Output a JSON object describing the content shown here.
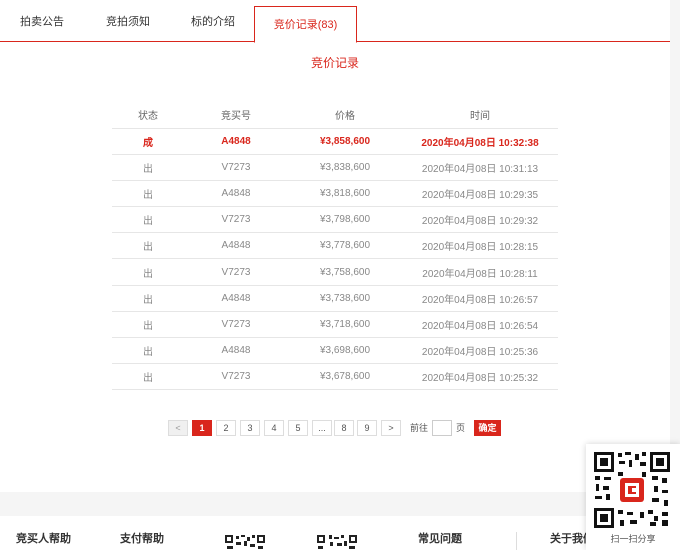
{
  "tabs": [
    {
      "label": "拍卖公告"
    },
    {
      "label": "竞拍须知"
    },
    {
      "label": "标的介绍"
    },
    {
      "label": "竞价记录(83)"
    }
  ],
  "section_title": "竞价记录",
  "table": {
    "headers": [
      "状态",
      "竞买号",
      "价格",
      "时间"
    ],
    "rows": [
      {
        "status": "成",
        "bidder": "A4848",
        "price": "¥3,858,600",
        "time": "2020年04月08日  10:32:38"
      },
      {
        "status": "出",
        "bidder": "V7273",
        "price": "¥3,838,600",
        "time": "2020年04月08日  10:31:13"
      },
      {
        "status": "出",
        "bidder": "A4848",
        "price": "¥3,818,600",
        "time": "2020年04月08日  10:29:35"
      },
      {
        "status": "出",
        "bidder": "V7273",
        "price": "¥3,798,600",
        "time": "2020年04月08日  10:29:32"
      },
      {
        "status": "出",
        "bidder": "A4848",
        "price": "¥3,778,600",
        "time": "2020年04月08日  10:28:15"
      },
      {
        "status": "出",
        "bidder": "V7273",
        "price": "¥3,758,600",
        "time": "2020年04月08日  10:28:11"
      },
      {
        "status": "出",
        "bidder": "A4848",
        "price": "¥3,738,600",
        "time": "2020年04月08日  10:26:57"
      },
      {
        "status": "出",
        "bidder": "V7273",
        "price": "¥3,718,600",
        "time": "2020年04月08日  10:26:54"
      },
      {
        "status": "出",
        "bidder": "A4848",
        "price": "¥3,698,600",
        "time": "2020年04月08日  10:25:36"
      },
      {
        "status": "出",
        "bidder": "V7273",
        "price": "¥3,678,600",
        "time": "2020年04月08日  10:25:32"
      }
    ]
  },
  "pagination": {
    "prev": "<",
    "next": ">",
    "pages": [
      "1",
      "2",
      "3",
      "4",
      "5",
      "...",
      "8",
      "9"
    ],
    "current": "1",
    "goto_label": "前往",
    "page_unit": "页",
    "confirm": "确定"
  },
  "footer": {
    "links": [
      "竞买人帮助",
      "支付帮助",
      "常见问题",
      "关于我们"
    ]
  },
  "qr": {
    "caption": "扫一扫分享"
  },
  "colors": {
    "accent": "#d9261c"
  }
}
